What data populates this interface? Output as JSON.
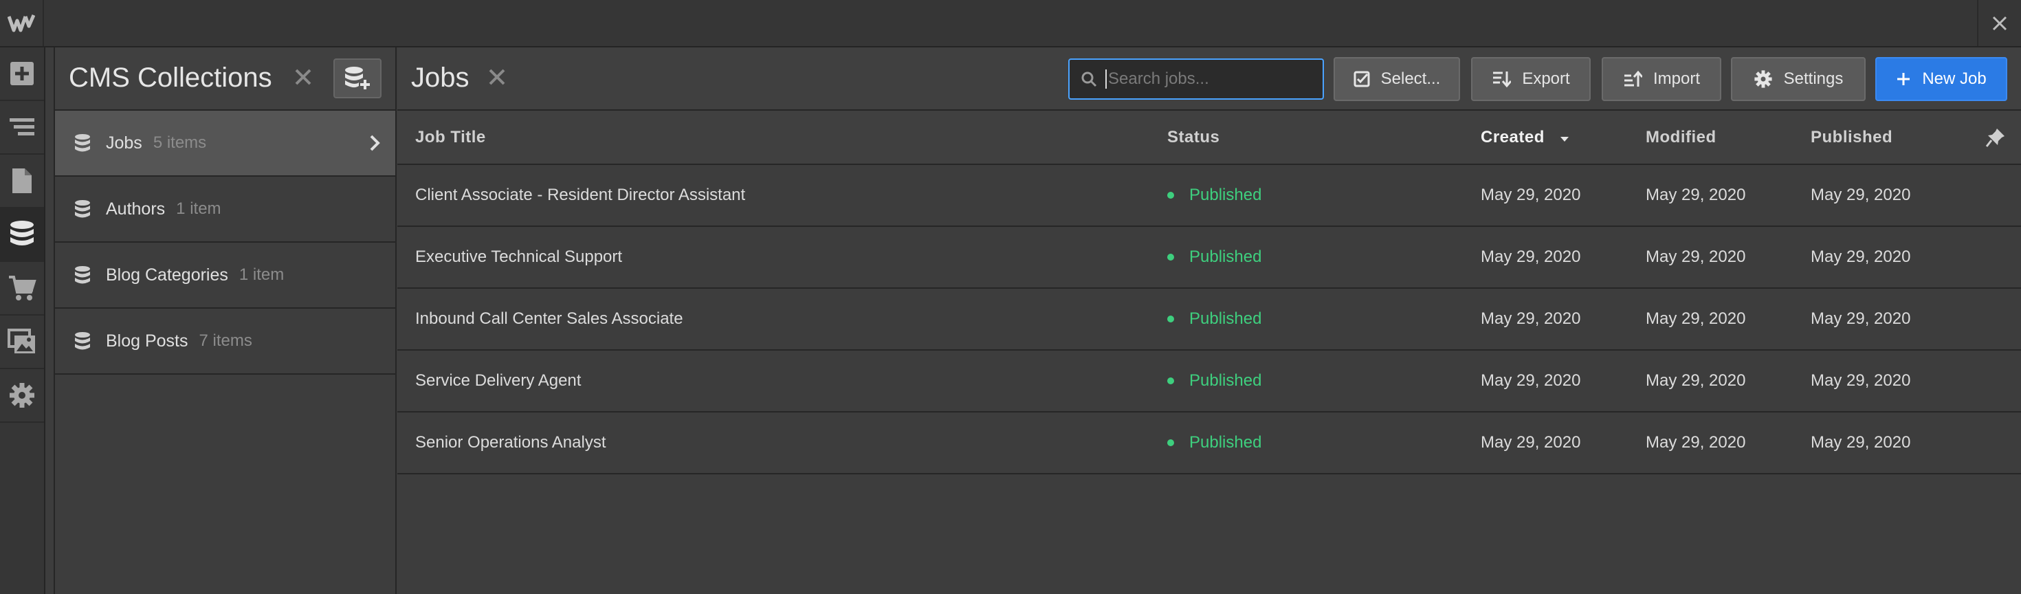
{
  "collections_panel": {
    "title": "CMS Collections",
    "items": [
      {
        "name": "Jobs",
        "count": "5 items"
      },
      {
        "name": "Authors",
        "count": "1 item"
      },
      {
        "name": "Blog Categories",
        "count": "1 item"
      },
      {
        "name": "Blog Posts",
        "count": "7 items"
      }
    ]
  },
  "main": {
    "title": "Jobs",
    "search": {
      "placeholder": "Search jobs...",
      "value": ""
    },
    "toolbar": {
      "select_label": "Select...",
      "export_label": "Export",
      "import_label": "Import",
      "settings_label": "Settings",
      "new_label": "New Job"
    },
    "columns": [
      "Job Title",
      "Status",
      "Created",
      "Modified",
      "Published"
    ],
    "rows": [
      {
        "title": "Client Associate - Resident Director Assistant",
        "status": "Published",
        "created": "May 29, 2020",
        "modified": "May 29, 2020",
        "published": "May 29, 2020"
      },
      {
        "title": "Executive Technical Support",
        "status": "Published",
        "created": "May 29, 2020",
        "modified": "May 29, 2020",
        "published": "May 29, 2020"
      },
      {
        "title": "Inbound Call Center Sales Associate",
        "status": "Published",
        "created": "May 29, 2020",
        "modified": "May 29, 2020",
        "published": "May 29, 2020"
      },
      {
        "title": "Service Delivery Agent",
        "status": "Published",
        "created": "May 29, 2020",
        "modified": "May 29, 2020",
        "published": "May 29, 2020"
      },
      {
        "title": "Senior Operations Analyst",
        "status": "Published",
        "created": "May 29, 2020",
        "modified": "May 29, 2020",
        "published": "May 29, 2020"
      }
    ]
  },
  "colors": {
    "accent": "#2b7be5",
    "published": "#3ecf7e",
    "search_border": "#4aa3ff"
  }
}
